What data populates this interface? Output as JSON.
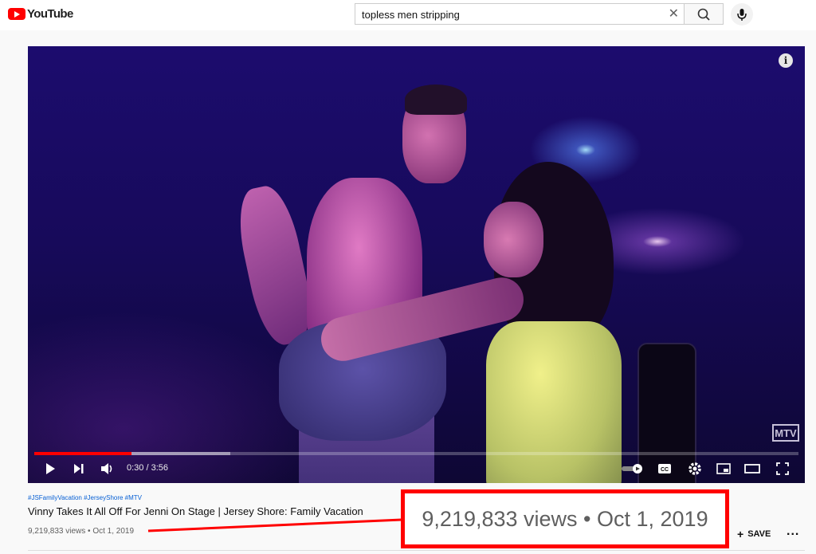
{
  "header": {
    "logo_text": "YouTube",
    "search_value": "topless men stripping",
    "icons": {
      "clear": "close-icon",
      "search": "search-icon",
      "mic": "microphone-icon"
    }
  },
  "player": {
    "watermark": "MTV",
    "time_display": "0:30 / 3:56",
    "progress_played": 0.127,
    "progress_buffered": 0.256,
    "icons": [
      "play-icon",
      "next-icon",
      "volume-icon",
      "autoplay-toggle-icon",
      "captions-icon",
      "settings-icon",
      "miniplayer-icon",
      "theater-icon",
      "fullscreen-icon",
      "info-icon"
    ]
  },
  "video": {
    "hashtags": "#JSFamilyVacation #JerseyShore #MTV",
    "title": "Vinny Takes It All Off For Jenni On Stage | Jersey Shore: Family Vacation",
    "stats": "9,219,833 views • Oct 1, 2019",
    "save_label": "SAVE",
    "more": "..."
  },
  "annotation": {
    "callout_text": "9,219,833 views • Oct 1, 2019",
    "color": "#ff0000"
  }
}
